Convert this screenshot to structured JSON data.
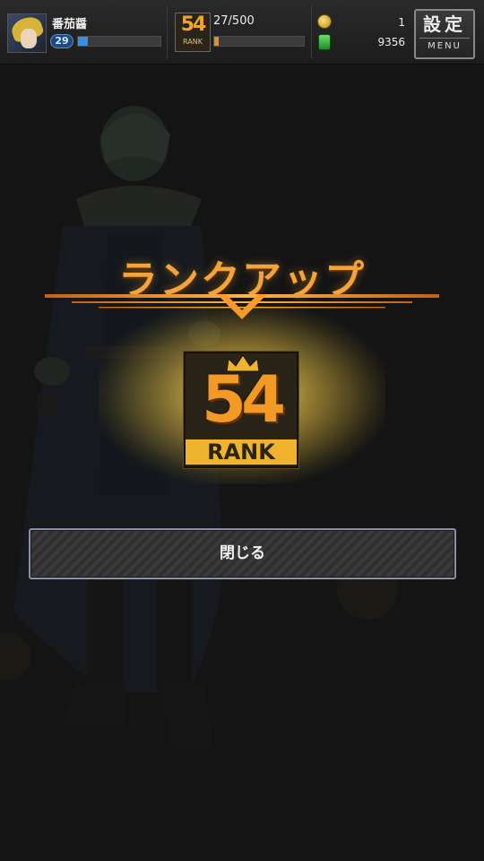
{
  "hud": {
    "player_name": "番茄醤",
    "level": "29",
    "exp_fraction": 0.12,
    "rank_icon_number": "54",
    "rank_icon_label": "RANK",
    "stamina_text": "27/500",
    "stamina_fraction": 0.05,
    "coins": "1",
    "gems": "9356",
    "menu_main": "設定",
    "menu_sub": "MENU"
  },
  "rankup": {
    "title": "ランクアップ",
    "rank_number": "54",
    "rank_label": "RANK",
    "close_label": "閉じる"
  },
  "colors": {
    "accent_orange": "#f2a33a",
    "glow_gold": "#f0d060",
    "button_border": "#8a90a6"
  }
}
